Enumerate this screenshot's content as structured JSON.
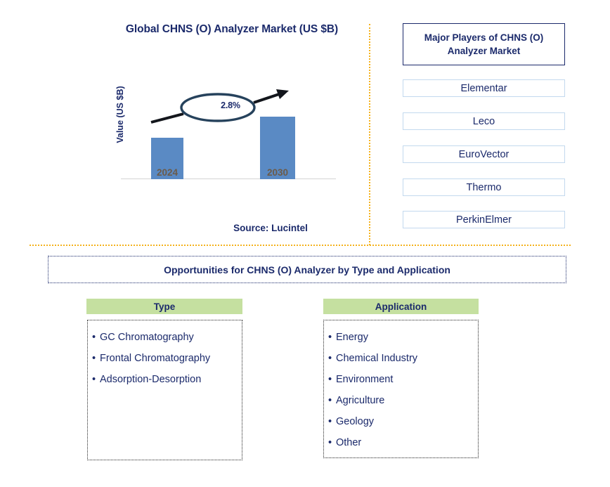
{
  "chart": {
    "title": "Global CHNS (O) Analyzer Market (US $B)",
    "y_axis_label": "Value (US $B)",
    "cagr_label": "2.8%",
    "source": "Source: Lucintel"
  },
  "chart_data": {
    "type": "bar",
    "title": "Global CHNS (O) Analyzer Market (US $B)",
    "categories": [
      "2024",
      "2030"
    ],
    "values": [
      59,
      89
    ],
    "xlabel": "",
    "ylabel": "Value (US $B)",
    "grid": false,
    "legend": "none",
    "annotations": [
      {
        "text": "2.8%",
        "type": "cagr-callout",
        "from": "2024",
        "to": "2030"
      }
    ],
    "bar_color": "#5a8ac4",
    "axis_color": "#d4d4d4",
    "tick_label_color": "#6b5b4a"
  },
  "players": {
    "header": "Major Players of CHNS (O) Analyzer Market",
    "items": [
      "Elementar",
      "Leco",
      "EuroVector",
      "Thermo",
      "PerkinElmer"
    ]
  },
  "opportunities": {
    "banner": "Opportunities for CHNS (O) Analyzer by Type and Application",
    "columns": [
      {
        "header": "Type",
        "items": [
          "GC Chromatography",
          "Frontal Chromatography",
          "Adsorption-Desorption"
        ]
      },
      {
        "header": "Application",
        "items": [
          "Energy",
          "Chemical Industry",
          "Environment",
          "Agriculture",
          "Geology",
          "Other"
        ]
      }
    ],
    "bullet": "•"
  },
  "colors": {
    "navy": "#1b2a6b",
    "bar_blue": "#5a8ac4",
    "green_header": "#c5e0a0",
    "divider_orange": "#f5b21c",
    "player_border": "#c3d9ee"
  }
}
